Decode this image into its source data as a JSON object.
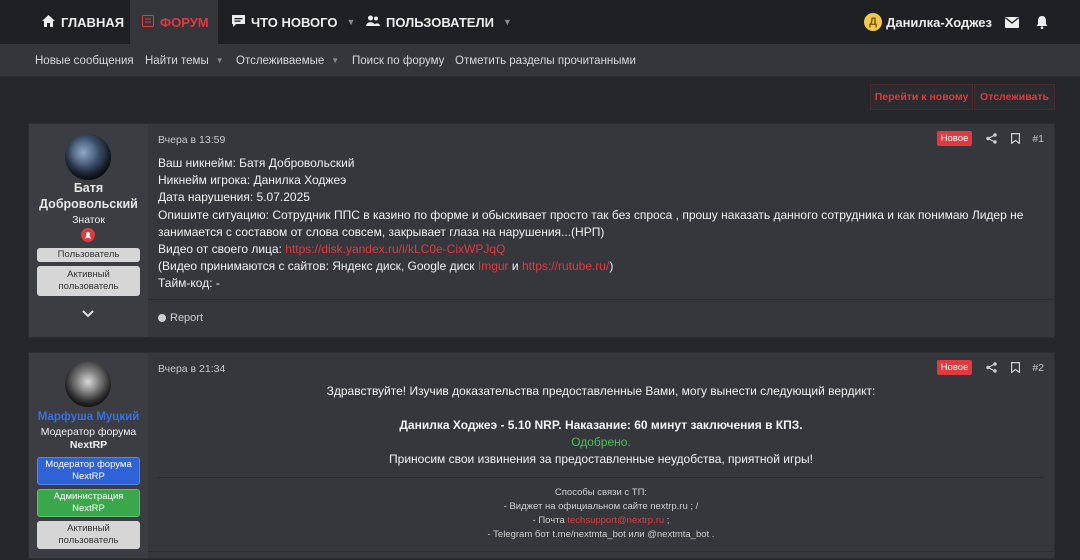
{
  "nav": {
    "home": "ГЛАВНАЯ",
    "forum": "ФОРУМ",
    "whats_new": "ЧТО НОВОГО",
    "users": "ПОЛЬЗОВАТЕЛИ",
    "user_initial": "Д",
    "username": "Данилка-Ходжез"
  },
  "subnav": {
    "new_messages": "Новые сообщения",
    "find_threads": "Найти темы",
    "watched": "Отслеживаемые",
    "search_forum": "Поиск по форуму",
    "mark_read": "Отметить разделы прочитанными"
  },
  "actions": {
    "go_new": "Перейти к новому",
    "watch": "Отслеживать"
  },
  "post1": {
    "author": "Батя Добровольский",
    "author_line1": "Батя",
    "author_line2": "Добровольский",
    "title": "Знаток",
    "badge1": "Пользователь",
    "badge2_l1": "Активный",
    "badge2_l2": "пользователь",
    "time": "Вчера в 13:59",
    "new_tag": "Новое",
    "number": "#1",
    "lines": {
      "l1": "Ваш никнейм: Батя Добровольский",
      "l2": "Никнейм игрока: Данилка Ходжеэ",
      "l3": "Дата нарушения: 5.07.2025",
      "l4": "Опишите ситуацию: Сотрудник ППС в казино по форме и обыскивает просто так без спроса , прошу наказать данного сотрудника и как понимаю Лидер не",
      "l5": "занимается с составом от слова совсем, закрывает глаза на нарушения...(НРП)",
      "l6_prefix": "Видео от своего лица: ",
      "l6_link": "https://disk.yandex.ru/i/kLC0e-CixWPJqQ",
      "l7_prefix": "(Видео принимаются с сайтов: Яндекс диск, Google диск ",
      "l7_link1": "Imgur",
      "l7_mid": " и ",
      "l7_link2": "https://rutube.ru/",
      "l7_suffix": ")",
      "l8": "Тайм-код: -"
    },
    "report": "Report"
  },
  "post2": {
    "author": "Марфуша Муцкий",
    "title_l1": "Модератор форума",
    "title_l2": "NextRP",
    "badge1_l1": "Модератор форума",
    "badge1_l2": "NextRP",
    "badge2_l1": "Администрация",
    "badge2_l2": "NextRP",
    "badge3_l1": "Активный",
    "badge3_l2": "пользователь",
    "time": "Вчера в 21:34",
    "new_tag": "Новое",
    "number": "#2",
    "greeting": "Здравствуйте! Изучив доказательства предоставленные Вами, могу вынести следующий вердикт:",
    "verdict": "Данилка Ходжеэ - 5.10 NRP. Наказание: 60 минут заключения в КПЗ.",
    "approved": "Одобрено.",
    "apology": "Приносим свои извинения за предоставленные неудобства, приятной игры!",
    "contact_title": "Способы связи с ТП:",
    "contact1": "- Виджет на официальном сайте nextrp.ru ; /",
    "contact2_prefix": "- Почта ",
    "contact2_link": "techsupport@nextrp.ru",
    "contact2_suffix": " ;",
    "contact3": "- Telegram бот t.me/nextmta_bot или @nextmta_bot ."
  },
  "colors": {
    "accent": "#e0393e",
    "approved": "#4fbf5a",
    "moderator_name": "#3b6fe0"
  }
}
